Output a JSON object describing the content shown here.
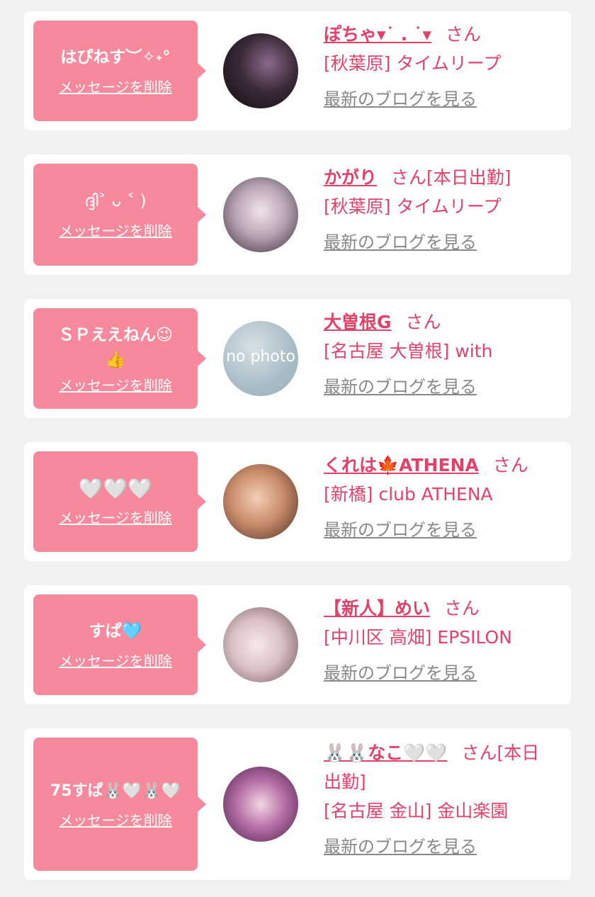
{
  "common": {
    "delete_label": "メッセージを削除",
    "blog_label": "最新のブログを見る",
    "san_suffix": "さん",
    "accent_color": "#e0436a",
    "bubble_color": "#f7899c"
  },
  "messages": [
    {
      "message": "はぴねす︶✧˖°",
      "name": "ぽちゃ▾˙ . ˙▾",
      "status": "",
      "shop": "[秋葉原] タイムリープ",
      "avatar": "photo"
    },
    {
      "message": "ദ്ദി˃ ᴗ ˂ )",
      "name": "かがり",
      "status": "[本日出勤]",
      "shop": "[秋葉原] タイムリープ",
      "avatar": "photo"
    },
    {
      "message": "ＳＰええねん😉👍",
      "name": "大曽根G",
      "status": "",
      "shop": "[名古屋 大曽根] with",
      "avatar": "no photo"
    },
    {
      "message": "🤍🤍🤍",
      "name": "くれは🍁ATHENA",
      "status": "",
      "shop": "[新橋] club ATHENA",
      "avatar": "photo"
    },
    {
      "message": "すぱ🩵",
      "name": "【新人】めい",
      "status": "",
      "shop": "[中川区 高畑] EPSILON",
      "avatar": "photo"
    },
    {
      "message": "75すぱ🐰🤍🐰🤍",
      "name": "🐰🐰なこ🤍🤍",
      "status": "[本日出勤]",
      "shop": "[名古屋 金山] 金山楽園",
      "avatar": "photo"
    }
  ]
}
